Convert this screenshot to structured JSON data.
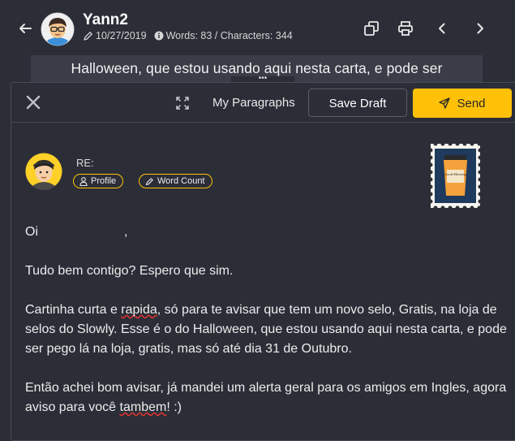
{
  "header": {
    "name": "Yann2",
    "date": "10/27/2019",
    "stats": "Words: 83 / Characters: 344",
    "background_text": "Halloween, que estou usando aqui nesta carta, e pode ser",
    "icons": [
      "back-arrow-icon",
      "pencil-icon",
      "info-icon",
      "copy-icon",
      "printer-icon",
      "chevron-left-icon",
      "chevron-right-icon"
    ]
  },
  "compose": {
    "toolbar": {
      "my_paragraphs": "My Paragraphs",
      "save_draft": "Save Draft",
      "send": "Send"
    },
    "recipient": {
      "re_label": "RE:",
      "profile_label": "Profile",
      "word_count_label": "Word Count"
    },
    "stamp_text": "Good Morning",
    "body": {
      "greeting_start": "Oi",
      "greeting_end": ",",
      "p2": "Tudo bem contigo? Espero que sim.",
      "p3_a": "Cartinha curta e ",
      "p3_word": "rapida",
      "p3_b": ", só para te avisar que tem um novo selo, Gratis, na loja de selos do Slowly. Esse é o do Halloween, que estou usando aqui nesta carta, e pode ser pego lá na loja, gratis, mas só até dia 31 de Outubro.",
      "p4_a": "Então achei bom avisar, já mandei um alerta geral para os amigos em Ingles, agora aviso para você ",
      "p4_word": "tambem",
      "p4_b": "! :)"
    }
  },
  "colors": {
    "background": "#2b2e37",
    "accent": "#ffc107",
    "border": "#484b55"
  }
}
